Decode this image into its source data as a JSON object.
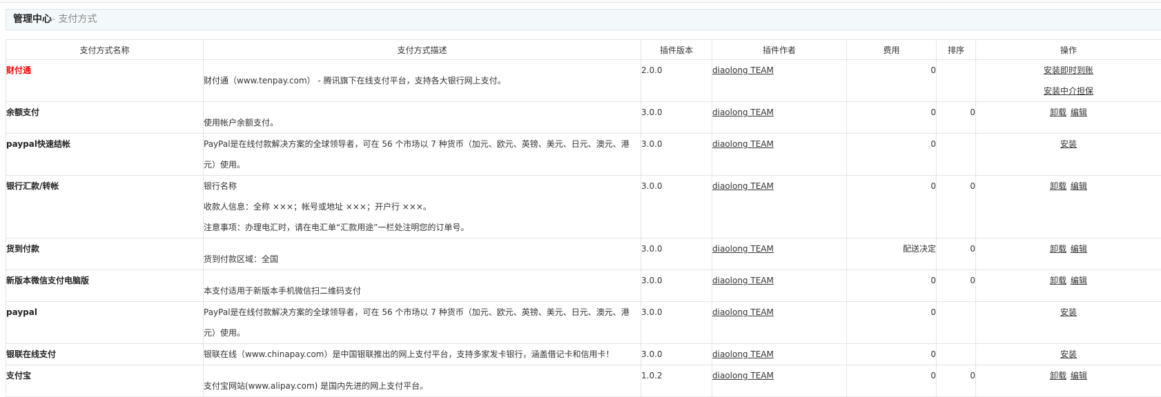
{
  "header": {
    "title": "管理中心",
    "separator": "- ",
    "subtitle": "支付方式"
  },
  "columns": [
    "支付方式名称",
    "支付方式描述",
    "插件版本",
    "插件作者",
    "费用",
    "排序",
    "操作"
  ],
  "rows": [
    {
      "name": "财付通",
      "highlight": true,
      "desc": [
        "财付通（www.tenpay.com） - 腾讯旗下在线支付平台，支持各大银行网上支付。"
      ],
      "version": "2.0.0",
      "author": "diaolong TEAM",
      "fee": "0",
      "sort": "",
      "actions": [
        "安装即时到账",
        "安装中介担保"
      ]
    },
    {
      "name": "余额支付",
      "desc": [
        "使用帐户余额支付。"
      ],
      "version": "3.0.0",
      "author": "diaolong TEAM",
      "fee": "0",
      "sort": "0",
      "actions": [
        "卸载",
        "编辑"
      ]
    },
    {
      "name": "paypal快速结帐",
      "desc": [
        "PayPal是在线付款解决方案的全球领导者，可在 56 个市场以 7 种货币（加元、欧元、英镑、美元、日元、澳元、港元）使用。"
      ],
      "version": "3.0.0",
      "author": "diaolong TEAM",
      "fee": "0",
      "sort": "",
      "actions": [
        "安装"
      ]
    },
    {
      "name": "银行汇款/转帐",
      "desc": [
        "银行名称",
        "收款人信息：全称 ×××；帐号或地址 ×××；开户行 ×××。",
        "注意事项：办理电汇时，请在电汇单“汇款用途”一栏处注明您的订单号。"
      ],
      "version": "3.0.0",
      "author": "diaolong TEAM",
      "fee": "0",
      "sort": "0",
      "actions": [
        "卸载",
        "编辑"
      ]
    },
    {
      "name": "货到付款",
      "desc": [
        "货到付款区域：全国"
      ],
      "version": "3.0.0",
      "author": "diaolong TEAM",
      "fee": "配送决定",
      "sort": "0",
      "actions": [
        "卸载",
        "编辑"
      ]
    },
    {
      "name": "新版本微信支付电脑版",
      "desc": [
        "本支付适用于新版本手机微信扫二维码支付"
      ],
      "version": "3.0.0",
      "author": "diaolong TEAM",
      "fee": "0",
      "sort": "0",
      "actions": [
        "卸载",
        "编辑"
      ]
    },
    {
      "name": "paypal",
      "desc": [
        "PayPal是在线付款解决方案的全球领导者，可在 56 个市场以 7 种货币（加元、欧元、英镑、美元、日元、澳元、港元）使用。"
      ],
      "version": "3.0.0",
      "author": "diaolong TEAM",
      "fee": "0",
      "sort": "",
      "actions": [
        "安装"
      ]
    },
    {
      "name": "银联在线支付",
      "desc": [
        "银联在线（www.chinapay.com）是中国银联推出的网上支付平台，支持多家发卡银行，涵盖借记卡和信用卡！"
      ],
      "version": "3.0.0",
      "author": "diaolong TEAM",
      "fee": "0",
      "sort": "",
      "actions": [
        "安装"
      ]
    },
    {
      "name": "支付宝",
      "desc": [
        "支付宝网站(www.alipay.com) 是国内先进的网上支付平台。"
      ],
      "version": "1.0.2",
      "author": "diaolong TEAM",
      "fee": "0",
      "sort": "0",
      "actions": [
        "卸载",
        "编辑"
      ]
    }
  ]
}
